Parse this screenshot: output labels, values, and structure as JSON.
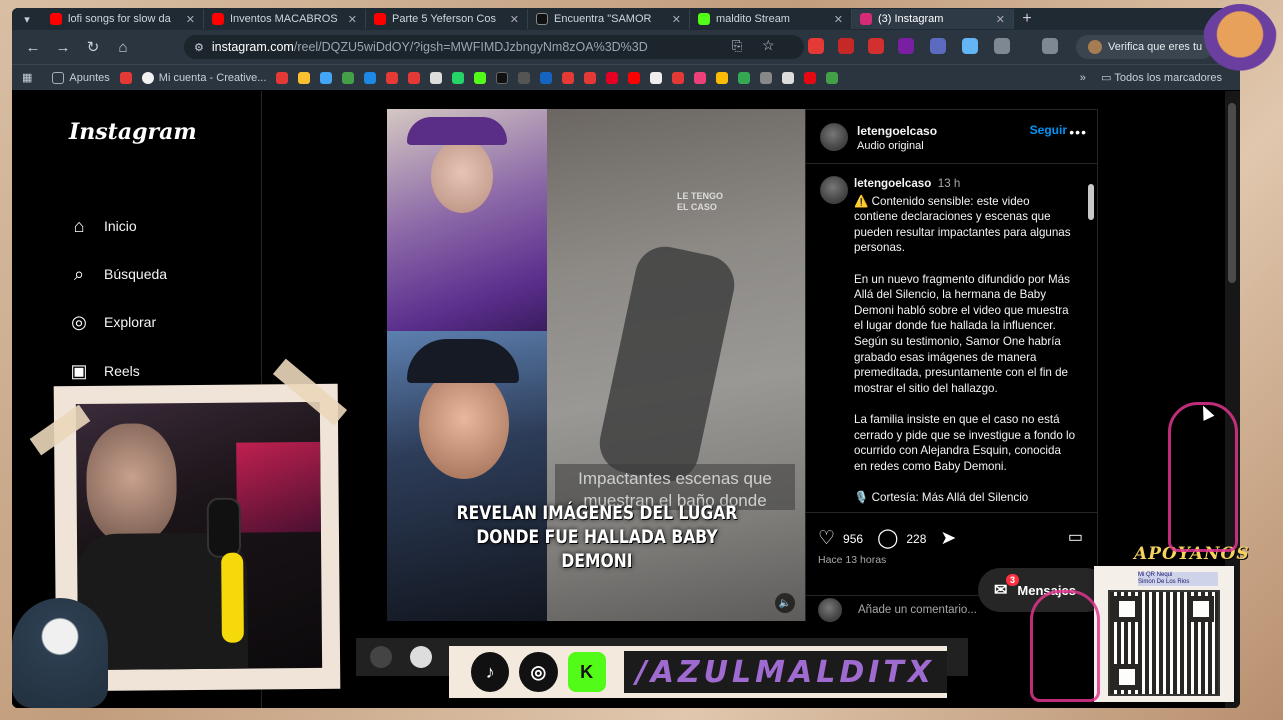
{
  "browser": {
    "tabs": [
      {
        "title": "lofi songs for slow da",
        "color": "#ff0000"
      },
      {
        "title": "Inventos MACABROS",
        "color": "#ff0000"
      },
      {
        "title": "Parte 5 Yeferson Cos",
        "color": "#ff0000"
      },
      {
        "title": "Encuentra \"SAMOR",
        "color": "#111111"
      },
      {
        "title": "maldito Stream",
        "color": "#53fc18"
      },
      {
        "title": "(3) Instagram",
        "color": "#d62976"
      }
    ],
    "url_domain": "instagram.com",
    "url_path": "/reel/DQZU5wiDdOY/?igsh=MWFIMDJzbngyNm8zOA%3D%3D",
    "profile_button": "Verifica que eres tu",
    "bookmarks": [
      {
        "label": "Apuntes",
        "color": "#5f6b77"
      },
      {
        "label": "Mi cuenta - Creative...",
        "color": "#f2f2f2"
      }
    ],
    "bookmarks_all": "Todos los marcadores"
  },
  "instagram": {
    "logo": "Instagram",
    "nav": [
      {
        "label": "Inicio",
        "icon": "home-icon",
        "glyph": "⌂"
      },
      {
        "label": "Búsqueda",
        "icon": "search-icon",
        "glyph": "⌕"
      },
      {
        "label": "Explorar",
        "icon": "compass-icon",
        "glyph": "◎"
      },
      {
        "label": "Reels",
        "icon": "reels-icon",
        "glyph": "▣"
      }
    ],
    "reel": {
      "watermark": "LE TENGO\nEL CASO",
      "subtitle_overlay": "Impactantes escenas que muestran el baño donde",
      "caption": "REVELAN IMÁGENES DEL LUGAR DONDE FUE HALLADA BABY DEMONI"
    },
    "panel": {
      "username": "letengoelcaso",
      "audio": "Audio original",
      "follow_label": "Seguir",
      "more_label": "•••",
      "post_username": "letengoelcaso",
      "post_time": "13 h",
      "post_paragraphs": [
        "⚠️ Contenido sensible: este video contiene declaraciones y escenas que pueden resultar impactantes para algunas personas.",
        "En un nuevo fragmento difundido por Más Allá del Silencio, la hermana de Baby Demoni habló sobre el video que muestra el lugar donde fue hallada la influencer.\nSegún su testimonio, Samor One habría grabado esas imágenes de manera premeditada, presuntamente con el fin de mostrar el sitio del hallazgo.",
        "La familia insiste en que el caso no está cerrado y pide que se investigue a fondo lo ocurrido con Alejandra Esquin, conocida en redes como Baby Demoni.",
        "🎙️ Cortesía: Más Allá del Silencio"
      ],
      "likes": "956",
      "comments": "228",
      "time_ago": "Hace 13 horas",
      "comment_placeholder": "Añade un comentario..."
    },
    "messages": {
      "label": "Mensajes",
      "badge": "3"
    }
  },
  "overlay": {
    "apoyanos": "APOYANOS",
    "qr_label": "Mi QR Nequi\nSimon De Los Rios",
    "handle": "/AZULMALDITX",
    "social_icons": [
      {
        "name": "tiktok-icon",
        "glyph": "♪"
      },
      {
        "name": "instagram-icon",
        "glyph": "◎"
      },
      {
        "name": "kick-icon",
        "glyph": "K"
      }
    ]
  }
}
